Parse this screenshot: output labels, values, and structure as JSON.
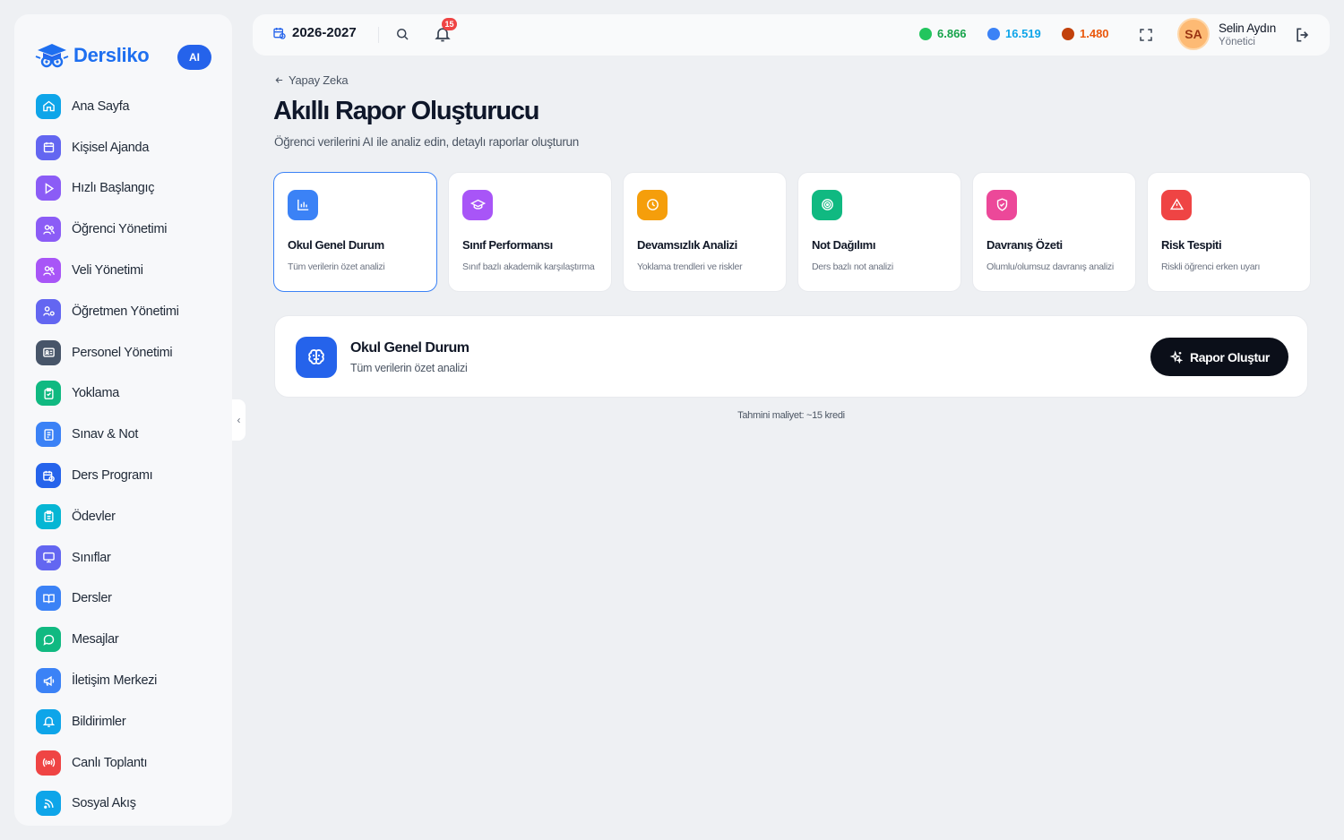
{
  "brand": {
    "name": "Dersliko",
    "ai_badge": "AI"
  },
  "sidebar": {
    "items": [
      {
        "label": "Ana Sayfa",
        "icon": "home-icon",
        "color": "#0ea5e9"
      },
      {
        "label": "Kişisel Ajanda",
        "icon": "calendar-icon",
        "color": "#6366f1"
      },
      {
        "label": "Hızlı Başlangıç",
        "icon": "play-icon",
        "color": "#8b5cf6"
      },
      {
        "label": "Öğrenci Yönetimi",
        "icon": "users-icon",
        "color": "#8b5cf6"
      },
      {
        "label": "Veli Yönetimi",
        "icon": "users-icon",
        "color": "#a855f7"
      },
      {
        "label": "Öğretmen Yönetimi",
        "icon": "teacher-icon",
        "color": "#6366f1"
      },
      {
        "label": "Personel Yönetimi",
        "icon": "id-card-icon",
        "color": "#475569"
      },
      {
        "label": "Yoklama",
        "icon": "clipboard-check-icon",
        "color": "#10b981"
      },
      {
        "label": "Sınav & Not",
        "icon": "exam-icon",
        "color": "#3b82f6"
      },
      {
        "label": "Ders Programı",
        "icon": "schedule-icon",
        "color": "#2563eb"
      },
      {
        "label": "Ödevler",
        "icon": "homework-icon",
        "color": "#06b6d4"
      },
      {
        "label": "Sınıflar",
        "icon": "monitor-icon",
        "color": "#6366f1"
      },
      {
        "label": "Dersler",
        "icon": "book-icon",
        "color": "#3b82f6"
      },
      {
        "label": "Mesajlar",
        "icon": "chat-icon",
        "color": "#10b981"
      },
      {
        "label": "İletişim Merkezi",
        "icon": "megaphone-icon",
        "color": "#3b82f6"
      },
      {
        "label": "Bildirimler",
        "icon": "bell-icon",
        "color": "#0ea5e9"
      },
      {
        "label": "Canlı Toplantı",
        "icon": "broadcast-icon",
        "color": "#ef4444"
      },
      {
        "label": "Sosyal Akış",
        "icon": "rss-icon",
        "color": "#0ea5e9"
      }
    ]
  },
  "topbar": {
    "year": "2026-2027",
    "notifications": "15",
    "stats": [
      {
        "value": "6.866",
        "color": "#16a34a"
      },
      {
        "value": "16.519",
        "color": "#0ea5e9"
      },
      {
        "value": "1.480",
        "color": "#ea580c"
      }
    ],
    "user": {
      "initials": "SA",
      "name": "Selin Aydın",
      "role": "Yönetici"
    }
  },
  "main": {
    "breadcrumb": "Yapay Zeka",
    "title": "Akıllı Rapor Oluşturucu",
    "subtitle": "Öğrenci verilerini AI ile analiz edin, detaylı raporlar oluşturun",
    "cards": [
      {
        "title": "Okul Genel Durum",
        "desc": "Tüm verilerin özet analizi",
        "icon": "bar-chart-icon",
        "color": "#3b82f6",
        "active": true
      },
      {
        "title": "Sınıf Performansı",
        "desc": "Sınıf bazlı akademik karşılaştırma",
        "icon": "graduation-cap-icon",
        "color": "#a855f7"
      },
      {
        "title": "Devamsızlık Analizi",
        "desc": "Yoklama trendleri ve riskler",
        "icon": "clock-icon",
        "color": "#f59e0b"
      },
      {
        "title": "Not Dağılımı",
        "desc": "Ders bazlı not analizi",
        "icon": "target-icon",
        "color": "#10b981"
      },
      {
        "title": "Davranış Özeti",
        "desc": "Olumlu/olumsuz davranış analizi",
        "icon": "shield-icon",
        "color": "#ec4899"
      },
      {
        "title": "Risk Tespiti",
        "desc": "Riskli öğrenci erken uyarı",
        "icon": "warning-icon",
        "color": "#ef4444"
      }
    ],
    "selected": {
      "title": "Okul Genel Durum",
      "desc": "Tüm verilerin özet analizi",
      "button": "Rapor Oluştur"
    },
    "cost": "Tahmini maliyet: ~15 kredi"
  }
}
